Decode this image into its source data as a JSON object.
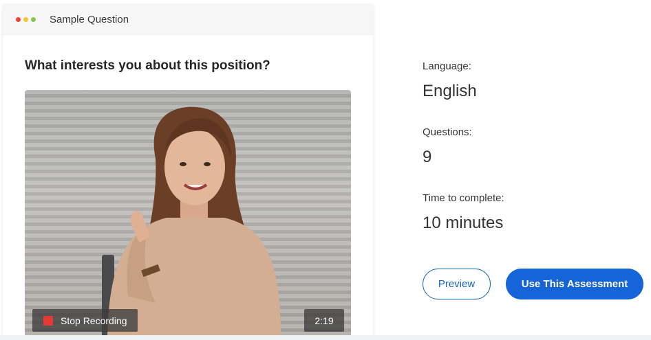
{
  "card": {
    "title": "Sample Question",
    "window_dots": {
      "colors": [
        "#f0443c",
        "#f5c430",
        "#8bc34a"
      ]
    },
    "question": "What interests you about this position?",
    "video": {
      "stop_label": "Stop Recording",
      "timer": "2:19",
      "stop_icon_color": "#e53935"
    }
  },
  "info": {
    "language_label": "Language:",
    "language_value": "English",
    "questions_label": "Questions:",
    "questions_value": "9",
    "time_label": "Time to complete:",
    "time_value": "10 minutes"
  },
  "actions": {
    "preview_label": "Preview",
    "use_label": "Use This Assessment",
    "accent_color": "#1565d8"
  }
}
